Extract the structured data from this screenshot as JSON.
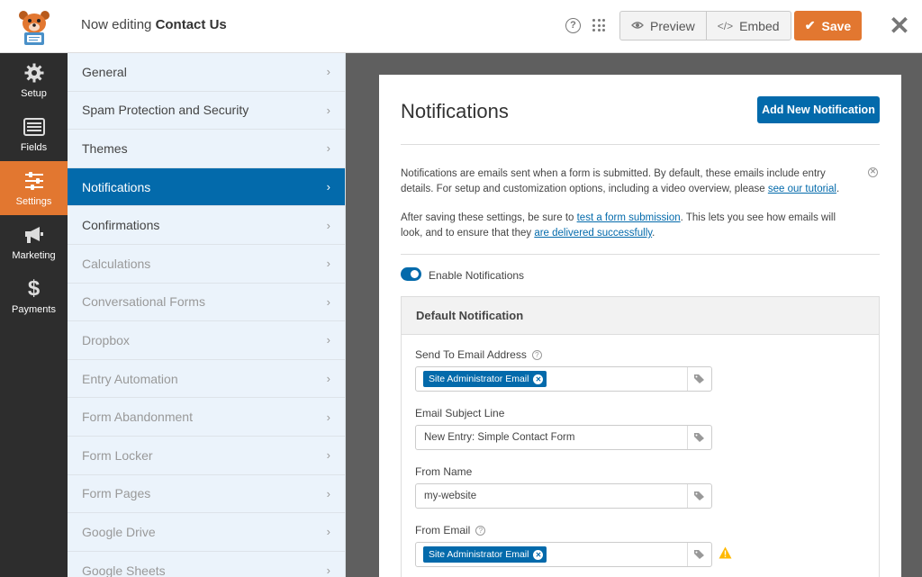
{
  "header": {
    "editing_prefix": "Now editing",
    "form_name": "Contact Us",
    "preview_label": "Preview",
    "embed_label": "Embed",
    "save_label": "Save"
  },
  "leftnav": {
    "items": [
      {
        "label": "Setup",
        "icon": "gear-icon"
      },
      {
        "label": "Fields",
        "icon": "fields-icon"
      },
      {
        "label": "Settings",
        "icon": "sliders-icon",
        "active": true
      },
      {
        "label": "Marketing",
        "icon": "megaphone-icon"
      },
      {
        "label": "Payments",
        "icon": "dollar-icon"
      }
    ]
  },
  "settings_menu": {
    "items": [
      {
        "label": "General"
      },
      {
        "label": "Spam Protection and Security"
      },
      {
        "label": "Themes"
      },
      {
        "label": "Notifications",
        "active": true
      },
      {
        "label": "Confirmations"
      },
      {
        "label": "Calculations",
        "disabled": true
      },
      {
        "label": "Conversational Forms",
        "disabled": true
      },
      {
        "label": "Dropbox",
        "disabled": true
      },
      {
        "label": "Entry Automation",
        "disabled": true
      },
      {
        "label": "Form Abandonment",
        "disabled": true
      },
      {
        "label": "Form Locker",
        "disabled": true
      },
      {
        "label": "Form Pages",
        "disabled": true
      },
      {
        "label": "Google Drive",
        "disabled": true
      },
      {
        "label": "Google Sheets",
        "disabled": true
      }
    ]
  },
  "panel": {
    "title": "Notifications",
    "add_button": "Add New Notification",
    "info1_a": "Notifications are emails sent when a form is submitted. By default, these emails include entry details. For setup and customization options, including a video overview, please ",
    "info1_link": "see our tutorial",
    "info1_b": ".",
    "info2_a": "After saving these settings, be sure to ",
    "info2_link1": "test a form submission",
    "info2_b": ". This lets you see how emails will look, and to ensure that they ",
    "info2_link2": "are delivered successfully",
    "info2_c": ".",
    "toggle_label": "Enable Notifications",
    "toggle_on": true
  },
  "notification": {
    "heading": "Default Notification",
    "send_to_label": "Send To Email Address",
    "send_to_chip": "Site Administrator Email",
    "subject_label": "Email Subject Line",
    "subject_value": "New Entry: Simple Contact Form",
    "from_name_label": "From Name",
    "from_name_value": "my-website",
    "from_email_label": "From Email",
    "from_email_chip": "Site Administrator Email"
  },
  "colors": {
    "accent_orange": "#e27730",
    "primary_blue": "#036aab",
    "nav_dark": "#2d2d2d",
    "warning_yellow": "#ffb900"
  }
}
